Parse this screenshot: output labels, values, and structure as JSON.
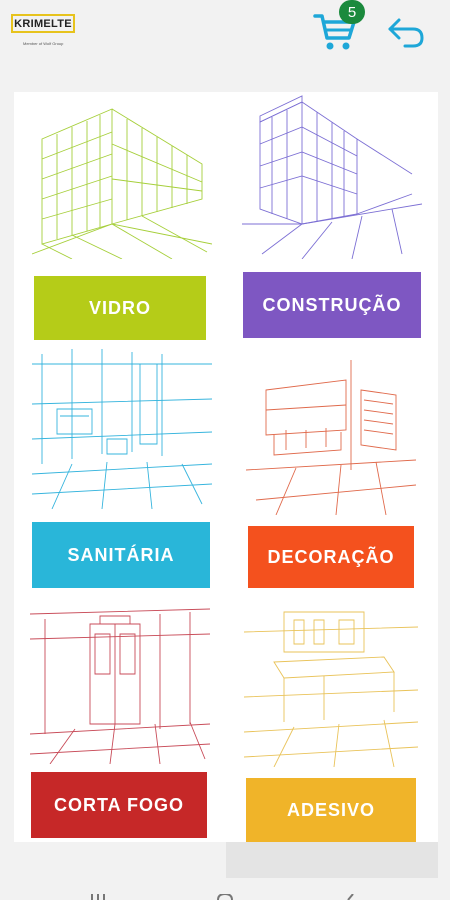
{
  "header": {
    "logo_text": "KRIMELTE",
    "logo_sub": "Member of Wolf Group",
    "cart_count": "5"
  },
  "categories": [
    {
      "label": "VIDRO",
      "color": "#b5cc18",
      "sketch": "#a6cf3a"
    },
    {
      "label": "CONSTRUÇÃO",
      "color": "#7e57c2",
      "sketch": "#7c6fd4"
    },
    {
      "label": "SANITÁRIA",
      "color": "#29b6d9",
      "sketch": "#35b4dd"
    },
    {
      "label": "DECORAÇÃO",
      "color": "#f4511e",
      "sketch": "#e06a4c"
    },
    {
      "label": "CORTA FOGO",
      "color": "#c62828",
      "sketch": "#c84b58"
    },
    {
      "label": "ADESIVO",
      "color": "#f0b429",
      "sketch": "#e9c35a"
    }
  ]
}
